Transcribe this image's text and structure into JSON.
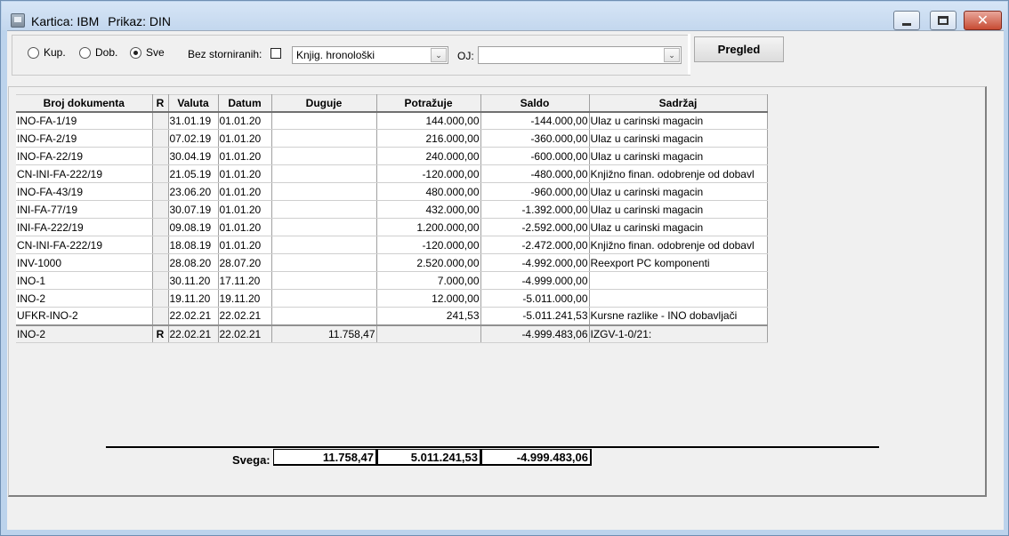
{
  "title": {
    "kartica": "Kartica: IBM",
    "prikaz": "Prikaz: DIN"
  },
  "filters": {
    "radios": [
      {
        "label": "Kup.",
        "checked": false
      },
      {
        "label": "Dob.",
        "checked": false
      },
      {
        "label": "Sve",
        "checked": true
      }
    ],
    "bez_storniranih_label": "Bez storniranih:",
    "sort_select_value": "Knjig. hronološki",
    "oj_label": "OJ:",
    "oj_value": ""
  },
  "buttons": {
    "pregled": "Pregled"
  },
  "table": {
    "headers": [
      "Broj dokumenta",
      "R",
      "Valuta",
      "Datum",
      "Duguje",
      "Potražuje",
      "Saldo",
      "Sadržaj"
    ],
    "rows": [
      [
        "INO-FA-1/19",
        "",
        "31.01.19",
        "01.01.20",
        "",
        "144.000,00",
        "-144.000,00",
        "Ulaz u carinski magacin"
      ],
      [
        "INO-FA-2/19",
        "",
        "07.02.19",
        "01.01.20",
        "",
        "216.000,00",
        "-360.000,00",
        "Ulaz u carinski magacin"
      ],
      [
        "INO-FA-22/19",
        "",
        "30.04.19",
        "01.01.20",
        "",
        "240.000,00",
        "-600.000,00",
        "Ulaz u carinski magacin"
      ],
      [
        "CN-INI-FA-222/19",
        "",
        "21.05.19",
        "01.01.20",
        "",
        "-120.000,00",
        "-480.000,00",
        "Knjižno finan. odobrenje od dobavl"
      ],
      [
        "INO-FA-43/19",
        "",
        "23.06.20",
        "01.01.20",
        "",
        "480.000,00",
        "-960.000,00",
        "Ulaz u carinski magacin"
      ],
      [
        "INI-FA-77/19",
        "",
        "30.07.19",
        "01.01.20",
        "",
        "432.000,00",
        "-1.392.000,00",
        "Ulaz u carinski magacin"
      ],
      [
        "INI-FA-222/19",
        "",
        "09.08.19",
        "01.01.20",
        "",
        "1.200.000,00",
        "-2.592.000,00",
        "Ulaz u carinski magacin"
      ],
      [
        "CN-INI-FA-222/19",
        "",
        "18.08.19",
        "01.01.20",
        "",
        "-120.000,00",
        "-2.472.000,00",
        "Knjižno finan. odobrenje od dobavl"
      ],
      [
        "INV-1000",
        "",
        "28.08.20",
        "28.07.20",
        "",
        "2.520.000,00",
        "-4.992.000,00",
        "Reexport PC komponenti"
      ],
      [
        "INO-1",
        "",
        "30.11.20",
        "17.11.20",
        "",
        "7.000,00",
        "-4.999.000,00",
        ""
      ],
      [
        "INO-2",
        "",
        "19.11.20",
        "19.11.20",
        "",
        "12.000,00",
        "-5.011.000,00",
        ""
      ],
      [
        "UFKR-INO-2",
        "",
        "22.02.21",
        "22.02.21",
        "",
        "241,53",
        "-5.011.241,53",
        " Kursne razlike - INO dobavljači"
      ],
      [
        "INO-2",
        "R",
        "22.02.21",
        "22.02.21",
        "11.758,47",
        "",
        "-4.999.483,06",
        "IZGV-1-0/21:"
      ]
    ]
  },
  "totals": {
    "label": "Svega:",
    "duguje": "11.758,47",
    "potrazuje": "5.011.241,53",
    "saldo": "-4.999.483,06"
  }
}
